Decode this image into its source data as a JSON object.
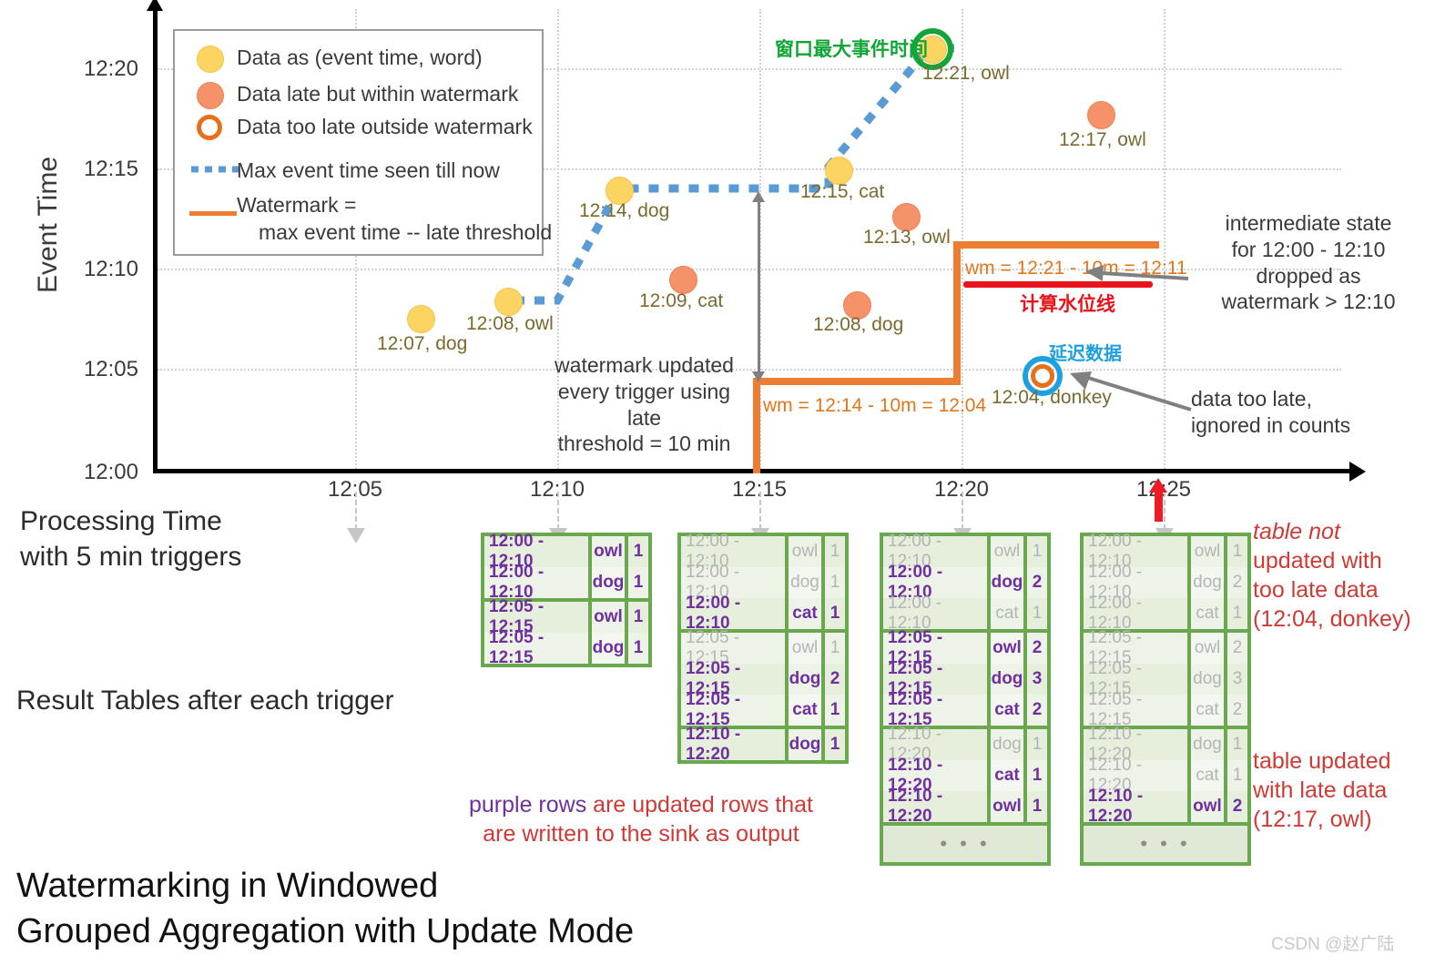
{
  "axes": {
    "y_title": "Event Time",
    "y_ticks": [
      "12:20",
      "12:15",
      "12:10",
      "12:05",
      "12:00"
    ],
    "x_ticks": [
      "12:05",
      "12:10",
      "12:15",
      "12:20",
      "12:25"
    ],
    "x_caption_line1": "Processing Time",
    "x_caption_line2": "with 5 min triggers"
  },
  "legend": {
    "items": [
      {
        "marker": "yellow-dot",
        "label": "Data as (event time, word)"
      },
      {
        "marker": "orange-dot",
        "label": "Data late but within watermark"
      },
      {
        "marker": "hollow-orange-dot",
        "label": "Data too late outside watermark"
      },
      {
        "marker": "blue-dotted-line",
        "label": "Max event time seen till now"
      },
      {
        "marker": "orange-solid-line",
        "label": "Watermark ="
      },
      {
        "marker": "none",
        "label": "max event time -- late threshold"
      }
    ]
  },
  "chart_data": {
    "type": "scatter",
    "title": "Watermarking in Windowed Grouped Aggregation with Update Mode",
    "xlabel": "Processing Time with 5 min triggers",
    "ylabel": "Event Time",
    "xlim": [
      "12:00",
      "12:27"
    ],
    "ylim": [
      "12:00",
      "12:22"
    ],
    "grid": true,
    "points": [
      {
        "label": "12:07, dog",
        "processing_time": "12:06",
        "event_time": "12:07",
        "kind": "on-time"
      },
      {
        "label": "12:08, owl",
        "processing_time": "12:08:30",
        "event_time": "12:08",
        "kind": "on-time"
      },
      {
        "label": "12:14, dog",
        "processing_time": "12:11:30",
        "event_time": "12:14",
        "kind": "on-time"
      },
      {
        "label": "12:09, cat",
        "processing_time": "12:13",
        "event_time": "12:09",
        "kind": "late-within"
      },
      {
        "label": "12:15, cat",
        "processing_time": "12:17",
        "event_time": "12:15",
        "kind": "on-time"
      },
      {
        "label": "12:13, owl",
        "processing_time": "12:18:30",
        "event_time": "12:13",
        "kind": "late-within"
      },
      {
        "label": "12:08, dog",
        "processing_time": "12:17:30",
        "event_time": "12:08",
        "kind": "late-within"
      },
      {
        "label": "12:21, owl",
        "processing_time": "12:19:30",
        "event_time": "12:21",
        "kind": "on-time-max"
      },
      {
        "label": "12:17, owl",
        "processing_time": "12:23:30",
        "event_time": "12:17",
        "kind": "late-within"
      },
      {
        "label": "12:04, donkey",
        "processing_time": "12:22",
        "event_time": "12:04",
        "kind": "too-late"
      }
    ],
    "max_event_time_series": {
      "name": "Max event time seen till now",
      "style": "blue dotted",
      "points": [
        [
          "12:08:30",
          "12:08"
        ],
        [
          "12:10",
          "12:08"
        ],
        [
          "12:11:30",
          "12:14"
        ],
        [
          "12:17",
          "12:14"
        ],
        [
          "12:17",
          "12:15"
        ],
        [
          "12:19:30",
          "12:21"
        ],
        [
          "12:20:30",
          "12:21"
        ]
      ]
    },
    "watermark_series": {
      "name": "Watermark = max event time -- late threshold",
      "style": "orange solid step",
      "steps": [
        [
          "12:15",
          "12:00"
        ],
        [
          "12:15",
          "12:04"
        ],
        [
          "12:20",
          "12:04"
        ],
        [
          "12:20",
          "12:11"
        ],
        [
          "12:25",
          "12:11"
        ]
      ]
    }
  },
  "annotations": {
    "max_event_cn": "窗口最大事件时间",
    "watermark_updated": "watermark updated\never trigger using late\nthreshold = 10 min",
    "watermark_updated_lines": [
      "watermark updated",
      "every trigger using late",
      "threshold = 10 min"
    ],
    "wm_label_1": "wm = 12:14 - 10m = 12:04",
    "wm_label_2": "wm = 12:21 - 10m = 12:11",
    "calc_watermark_cn": "计算水位线",
    "late_data_cn": "延迟数据",
    "intermediate_state_lines": [
      "intermediate state",
      "for 12:00 - 12:10",
      "dropped as",
      "watermark > 12:10"
    ],
    "data_too_late_lines": [
      "data too late,",
      "ignored in counts"
    ],
    "purple_rows_prefix": "purple rows",
    "purple_rows_rest": " are updated rows that",
    "purple_rows_line2": "are written to the sink as output",
    "table_not_updated_lines": [
      "table not",
      "updated with",
      "too late data",
      "(12:04, donkey)"
    ],
    "table_updated_lines": [
      "table updated",
      "with late data",
      "(12:17, owl)"
    ],
    "result_tables_caption": "Result Tables after each trigger",
    "title_line1_a": "Watermarking",
    "title_line1_b": " in ",
    "title_line1_c": "Windowed",
    "title_line2_a": "Grouped Aggregation",
    "title_line2_b": " with ",
    "title_line2_c": "Update Mode",
    "csdn": "CSDN @赵广陆"
  },
  "tables": [
    {
      "trigger": "12:10",
      "groups": [
        {
          "rows": [
            {
              "window": "12:00 - 12:10",
              "word": "owl",
              "count": "1",
              "updated": true
            },
            {
              "window": "12:00 - 12:10",
              "word": "dog",
              "count": "1",
              "updated": true
            }
          ]
        },
        {
          "rows": [
            {
              "window": "12:05 - 12:15",
              "word": "owl",
              "count": "1",
              "updated": true
            },
            {
              "window": "12:05 - 12:15",
              "word": "dog",
              "count": "1",
              "updated": true
            }
          ]
        }
      ],
      "ellipsis": false
    },
    {
      "trigger": "12:15",
      "groups": [
        {
          "rows": [
            {
              "window": "12:00 - 12:10",
              "word": "owl",
              "count": "1",
              "updated": false
            },
            {
              "window": "12:00 - 12:10",
              "word": "dog",
              "count": "1",
              "updated": false
            },
            {
              "window": "12:00 - 12:10",
              "word": "cat",
              "count": "1",
              "updated": true
            }
          ]
        },
        {
          "rows": [
            {
              "window": "12:05 - 12:15",
              "word": "owl",
              "count": "1",
              "updated": false
            },
            {
              "window": "12:05 - 12:15",
              "word": "dog",
              "count": "2",
              "updated": true
            },
            {
              "window": "12:05 - 12:15",
              "word": "cat",
              "count": "1",
              "updated": true
            }
          ]
        },
        {
          "rows": [
            {
              "window": "12:10 - 12:20",
              "word": "dog",
              "count": "1",
              "updated": true
            }
          ]
        }
      ],
      "ellipsis": false
    },
    {
      "trigger": "12:20",
      "groups": [
        {
          "rows": [
            {
              "window": "12:00 - 12:10",
              "word": "owl",
              "count": "1",
              "updated": false
            },
            {
              "window": "12:00 - 12:10",
              "word": "dog",
              "count": "2",
              "updated": true
            },
            {
              "window": "12:00 - 12:10",
              "word": "cat",
              "count": "1",
              "updated": false
            }
          ]
        },
        {
          "rows": [
            {
              "window": "12:05 - 12:15",
              "word": "owl",
              "count": "2",
              "updated": true
            },
            {
              "window": "12:05 - 12:15",
              "word": "dog",
              "count": "3",
              "updated": true
            },
            {
              "window": "12:05 - 12:15",
              "word": "cat",
              "count": "2",
              "updated": true
            }
          ]
        },
        {
          "rows": [
            {
              "window": "12:10 - 12:20",
              "word": "dog",
              "count": "1",
              "updated": false
            },
            {
              "window": "12:10 - 12:20",
              "word": "cat",
              "count": "1",
              "updated": true
            },
            {
              "window": "12:10 - 12:20",
              "word": "owl",
              "count": "1",
              "updated": true
            }
          ]
        }
      ],
      "ellipsis": true,
      "ellipsis_text": "• • •"
    },
    {
      "trigger": "12:25",
      "groups": [
        {
          "rows": [
            {
              "window": "12:00 - 12:10",
              "word": "owl",
              "count": "1",
              "updated": false
            },
            {
              "window": "12:00 - 12:10",
              "word": "dog",
              "count": "2",
              "updated": false
            },
            {
              "window": "12:00 - 12:10",
              "word": "cat",
              "count": "1",
              "updated": false
            }
          ]
        },
        {
          "rows": [
            {
              "window": "12:05 - 12:15",
              "word": "owl",
              "count": "2",
              "updated": false
            },
            {
              "window": "12:05 - 12:15",
              "word": "dog",
              "count": "3",
              "updated": false
            },
            {
              "window": "12:05 - 12:15",
              "word": "cat",
              "count": "2",
              "updated": false
            }
          ]
        },
        {
          "rows": [
            {
              "window": "12:10 - 12:20",
              "word": "dog",
              "count": "1",
              "updated": false
            },
            {
              "window": "12:10 - 12:20",
              "word": "cat",
              "count": "1",
              "updated": false
            },
            {
              "window": "12:10 - 12:20",
              "word": "owl",
              "count": "2",
              "updated": true
            }
          ]
        }
      ],
      "ellipsis": true,
      "ellipsis_text": "• • •"
    }
  ],
  "colors": {
    "yellow": "#fcd462",
    "orange": "#f5926a",
    "watermark_orange": "#ED7D31",
    "blue_dotted": "#5B9BD5",
    "green": "#6aa84f",
    "purple": "#7030A0",
    "red": "#cf3a35"
  }
}
